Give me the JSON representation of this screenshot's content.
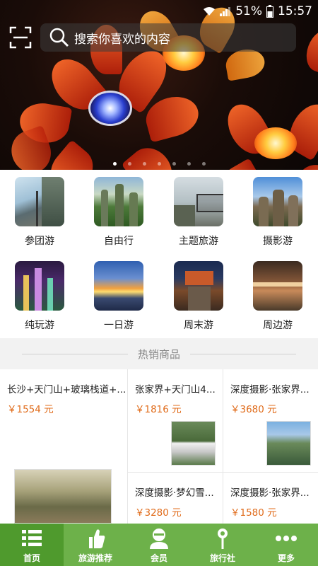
{
  "status_bar": {
    "battery": "51%",
    "time": "15:57"
  },
  "search": {
    "placeholder": "搜索你喜欢的内容"
  },
  "banner": {
    "slide_count": 7,
    "active_slide": 1
  },
  "categories": [
    {
      "label": "参团游",
      "icon": "glass-walkway-photo"
    },
    {
      "label": "自由行",
      "icon": "mountain-peaks-photo"
    },
    {
      "label": "主题旅游",
      "icon": "cliff-platform-photo"
    },
    {
      "label": "摄影游",
      "icon": "rock-pillars-photo"
    },
    {
      "label": "纯玩游",
      "icon": "cave-lights-photo"
    },
    {
      "label": "一日游",
      "icon": "sunset-clouds-photo"
    },
    {
      "label": "周末游",
      "icon": "old-town-night-photo"
    },
    {
      "label": "周边游",
      "icon": "cave-interior-photo"
    }
  ],
  "hot_section": {
    "title": "热销商品"
  },
  "products": [
    {
      "name": "长沙+天门山+玻璃栈道+...",
      "price": "￥1554 元"
    },
    {
      "name": "张家界+天门山4...",
      "price": "￥1816 元"
    },
    {
      "name": "深度摄影·张家界...",
      "price": "￥3680 元"
    },
    {
      "name": "深度摄影·梦幻雪...",
      "price": "￥3280 元"
    },
    {
      "name": "深度摄影·张家界...",
      "price": "￥1580 元"
    }
  ],
  "nav": [
    {
      "label": "首页",
      "icon": "list-icon",
      "active": true
    },
    {
      "label": "旅游推荐",
      "icon": "thumbs-up-icon",
      "active": false
    },
    {
      "label": "会员",
      "icon": "user-icon",
      "active": false
    },
    {
      "label": "旅行社",
      "icon": "location-pin-icon",
      "active": false
    },
    {
      "label": "更多",
      "icon": "more-dots-icon",
      "active": false
    }
  ],
  "colors": {
    "nav_bg": "#6db14a",
    "nav_active": "#4f9a2d",
    "price": "#e06b1a"
  }
}
